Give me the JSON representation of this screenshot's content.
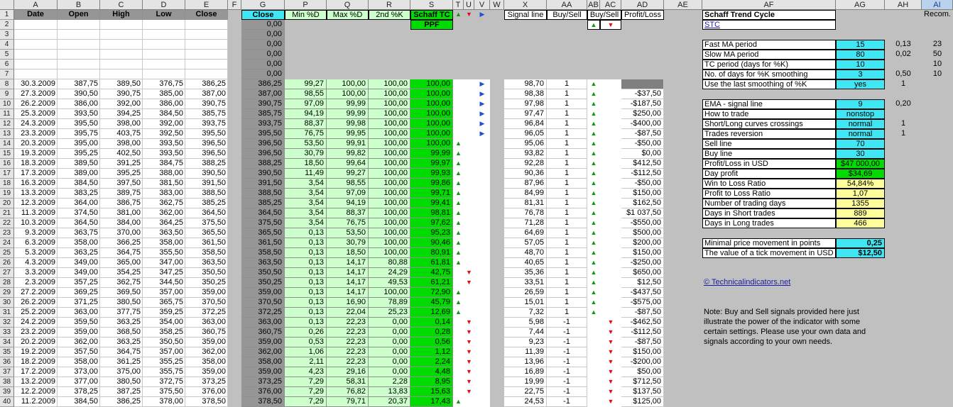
{
  "columns": [
    "",
    "A",
    "B",
    "C",
    "D",
    "E",
    "F",
    "G",
    "P",
    "Q",
    "R",
    "S",
    "T",
    "U",
    "V",
    "W",
    "X",
    "AA",
    "AB",
    "AC",
    "AD",
    "AE",
    "AF",
    "AG",
    "AH",
    "AI"
  ],
  "selected_column": "AI",
  "headers": {
    "A": "Date",
    "B": "Open",
    "C": "High",
    "D": "Low",
    "E": "Close",
    "G": "Close",
    "P": "Min %D",
    "Q": "Max %D",
    "R": "2nd %K",
    "S1": "Schaff TC",
    "S2": "PPF",
    "X": "Signal line",
    "AA": "Buy/Sell",
    "AC": "Buy/Sell",
    "AD": "Profit/Loss",
    "AF": "Schaff Trend Cycle",
    "AI": "Recom."
  },
  "top_arrows": {
    "T": "▲",
    "U": "▼",
    "V": "▶",
    "AB2": "▲",
    "AC2": "▼"
  },
  "stc_link": "STC",
  "empty_close": "0,00",
  "rows": [
    {
      "n": 8,
      "A": "30.3.2009",
      "B": "387,75",
      "C": "389,50",
      "D": "376,75",
      "E": "386,25",
      "G": "386,25",
      "P": "99,27",
      "Q": "100,00",
      "R": "100,00",
      "S": "100,00",
      "T": "",
      "U": "",
      "V": "▶",
      "X": "98,70",
      "AA": "1",
      "AB": "▲",
      "AC": "",
      "AD": ""
    },
    {
      "n": 9,
      "A": "27.3.2009",
      "B": "390,50",
      "C": "390,75",
      "D": "385,00",
      "E": "387,00",
      "G": "387,00",
      "P": "98,55",
      "Q": "100,00",
      "R": "100,00",
      "S": "100,00",
      "T": "",
      "U": "",
      "V": "▶",
      "X": "98,38",
      "AA": "1",
      "AB": "▲",
      "AC": "",
      "AD": "-$37,50"
    },
    {
      "n": 10,
      "A": "26.2.2009",
      "B": "386,00",
      "C": "392,00",
      "D": "386,00",
      "E": "390,75",
      "G": "390,75",
      "P": "97,09",
      "Q": "99,99",
      "R": "100,00",
      "S": "100,00",
      "T": "",
      "U": "",
      "V": "▶",
      "X": "97,98",
      "AA": "1",
      "AB": "▲",
      "AC": "",
      "AD": "-$187,50"
    },
    {
      "n": 11,
      "A": "25.3.2009",
      "B": "393,50",
      "C": "394,25",
      "D": "384,50",
      "E": "385,75",
      "G": "385,75",
      "P": "94,19",
      "Q": "99,99",
      "R": "100,00",
      "S": "100,00",
      "T": "",
      "U": "",
      "V": "▶",
      "X": "97,47",
      "AA": "1",
      "AB": "▲",
      "AC": "",
      "AD": "$250,00"
    },
    {
      "n": 12,
      "A": "24.3.2009",
      "B": "395,50",
      "C": "398,00",
      "D": "392,00",
      "E": "393,75",
      "G": "393,75",
      "P": "88,37",
      "Q": "99,98",
      "R": "100,00",
      "S": "100,00",
      "T": "",
      "U": "",
      "V": "▶",
      "X": "96,84",
      "AA": "1",
      "AB": "▲",
      "AC": "",
      "AD": "-$400,00"
    },
    {
      "n": 13,
      "A": "23.3.2009",
      "B": "395,75",
      "C": "403,75",
      "D": "392,50",
      "E": "395,50",
      "G": "395,50",
      "P": "76,75",
      "Q": "99,95",
      "R": "100,00",
      "S": "100,00",
      "T": "",
      "U": "",
      "V": "▶",
      "X": "96,05",
      "AA": "1",
      "AB": "▲",
      "AC": "",
      "AD": "-$87,50"
    },
    {
      "n": 14,
      "A": "20.3.2009",
      "B": "395,00",
      "C": "398,00",
      "D": "393,50",
      "E": "396,50",
      "G": "396,50",
      "P": "53,50",
      "Q": "99,91",
      "R": "100,00",
      "S": "100,00",
      "T": "▲",
      "U": "",
      "V": "",
      "X": "95,06",
      "AA": "1",
      "AB": "▲",
      "AC": "",
      "AD": "-$50,00"
    },
    {
      "n": 15,
      "A": "19.3.2009",
      "B": "395,25",
      "C": "402,50",
      "D": "393,50",
      "E": "396,50",
      "G": "396,50",
      "P": "30,79",
      "Q": "99,82",
      "R": "100,00",
      "S": "99,99",
      "T": "▲",
      "U": "",
      "V": "",
      "X": "93,82",
      "AA": "1",
      "AB": "▲",
      "AC": "",
      "AD": "$0,00"
    },
    {
      "n": 16,
      "A": "18.3.2009",
      "B": "389,50",
      "C": "391,25",
      "D": "384,75",
      "E": "388,25",
      "G": "388,25",
      "P": "18,50",
      "Q": "99,64",
      "R": "100,00",
      "S": "99,97",
      "T": "▲",
      "U": "",
      "V": "",
      "X": "92,28",
      "AA": "1",
      "AB": "▲",
      "AC": "",
      "AD": "$412,50"
    },
    {
      "n": 17,
      "A": "17.3.2009",
      "B": "389,00",
      "C": "395,25",
      "D": "388,00",
      "E": "390,50",
      "G": "390,50",
      "P": "11,49",
      "Q": "99,27",
      "R": "100,00",
      "S": "99,93",
      "T": "▲",
      "U": "",
      "V": "",
      "X": "90,36",
      "AA": "1",
      "AB": "▲",
      "AC": "",
      "AD": "-$112,50"
    },
    {
      "n": 18,
      "A": "16.3.2009",
      "B": "384,50",
      "C": "397,50",
      "D": "381,50",
      "E": "391,50",
      "G": "391,50",
      "P": "3,54",
      "Q": "98,55",
      "R": "100,00",
      "S": "99,86",
      "T": "▲",
      "U": "",
      "V": "",
      "X": "87,96",
      "AA": "1",
      "AB": "▲",
      "AC": "",
      "AD": "-$50,00"
    },
    {
      "n": 19,
      "A": "13.3.2009",
      "B": "383,25",
      "C": "389,75",
      "D": "383,00",
      "E": "388,50",
      "G": "388,50",
      "P": "3,54",
      "Q": "97,09",
      "R": "100,00",
      "S": "99,71",
      "T": "▲",
      "U": "",
      "V": "",
      "X": "84,99",
      "AA": "1",
      "AB": "▲",
      "AC": "",
      "AD": "$150,00"
    },
    {
      "n": 20,
      "A": "12.3.2009",
      "B": "364,00",
      "C": "386,75",
      "D": "362,75",
      "E": "385,25",
      "G": "385,25",
      "P": "3,54",
      "Q": "94,19",
      "R": "100,00",
      "S": "99,41",
      "T": "▲",
      "U": "",
      "V": "",
      "X": "81,31",
      "AA": "1",
      "AB": "▲",
      "AC": "",
      "AD": "$162,50"
    },
    {
      "n": 21,
      "A": "11.3.2009",
      "B": "374,50",
      "C": "381,00",
      "D": "362,00",
      "E": "364,50",
      "G": "364,50",
      "P": "3,54",
      "Q": "88,37",
      "R": "100,00",
      "S": "98,81",
      "T": "▲",
      "U": "",
      "V": "",
      "X": "76,78",
      "AA": "1",
      "AB": "▲",
      "AC": "",
      "AD": "$1 037,50"
    },
    {
      "n": 22,
      "A": "10.3.2009",
      "B": "364,50",
      "C": "384,00",
      "D": "364,25",
      "E": "375,50",
      "G": "375,50",
      "P": "3,54",
      "Q": "76,75",
      "R": "100,00",
      "S": "97,62",
      "T": "▲",
      "U": "",
      "V": "",
      "X": "71,28",
      "AA": "1",
      "AB": "▲",
      "AC": "",
      "AD": "-$550,00"
    },
    {
      "n": 23,
      "A": "9.3.2009",
      "B": "363,75",
      "C": "370,00",
      "D": "363,50",
      "E": "365,50",
      "G": "365,50",
      "P": "0,13",
      "Q": "53,50",
      "R": "100,00",
      "S": "95,23",
      "T": "▲",
      "U": "",
      "V": "",
      "X": "64,69",
      "AA": "1",
      "AB": "▲",
      "AC": "",
      "AD": "$500,00"
    },
    {
      "n": 24,
      "A": "6.3.2009",
      "B": "358,00",
      "C": "366,25",
      "D": "358,00",
      "E": "361,50",
      "G": "361,50",
      "P": "0,13",
      "Q": "30,79",
      "R": "100,00",
      "S": "90,46",
      "T": "▲",
      "U": "",
      "V": "",
      "X": "57,05",
      "AA": "1",
      "AB": "▲",
      "AC": "",
      "AD": "$200,00"
    },
    {
      "n": 25,
      "A": "5.3.2009",
      "B": "363,25",
      "C": "364,75",
      "D": "355,50",
      "E": "358,50",
      "G": "358,50",
      "P": "0,13",
      "Q": "18,50",
      "R": "100,00",
      "S": "80,91",
      "T": "▲",
      "U": "",
      "V": "",
      "X": "48,70",
      "AA": "1",
      "AB": "▲",
      "AC": "",
      "AD": "$150,00"
    },
    {
      "n": 26,
      "A": "4.3.2009",
      "B": "349,00",
      "C": "365,00",
      "D": "347,00",
      "E": "363,50",
      "G": "363,50",
      "P": "0,13",
      "Q": "14,17",
      "R": "80,88",
      "S": "61,81",
      "T": "▲",
      "U": "",
      "V": "",
      "X": "40,65",
      "AA": "1",
      "AB": "▲",
      "AC": "",
      "AD": "-$250,00"
    },
    {
      "n": 27,
      "A": "3.3.2009",
      "B": "349,00",
      "C": "354,25",
      "D": "347,25",
      "E": "350,50",
      "G": "350,50",
      "P": "0,13",
      "Q": "14,17",
      "R": "24,29",
      "S": "42,75",
      "T": "",
      "U": "▼",
      "V": "",
      "X": "35,36",
      "AA": "1",
      "AB": "▲",
      "AC": "",
      "AD": "$650,00"
    },
    {
      "n": 28,
      "A": "2.3.2009",
      "B": "357,25",
      "C": "362,75",
      "D": "344,50",
      "E": "350,25",
      "G": "350,25",
      "P": "0,13",
      "Q": "14,17",
      "R": "49,53",
      "S": "61,21",
      "T": "",
      "U": "▼",
      "V": "",
      "X": "33,51",
      "AA": "1",
      "AB": "▲",
      "AC": "",
      "AD": "$12,50"
    },
    {
      "n": 29,
      "A": "27.2.2009",
      "B": "369,25",
      "C": "369,50",
      "D": "357,00",
      "E": "359,00",
      "G": "359,00",
      "P": "0,13",
      "Q": "14,17",
      "R": "100,00",
      "S": "72,90",
      "T": "▲",
      "U": "",
      "V": "",
      "X": "26,59",
      "AA": "1",
      "AB": "▲",
      "AC": "",
      "AD": "-$437,50"
    },
    {
      "n": 30,
      "A": "26.2.2009",
      "B": "371,25",
      "C": "380,50",
      "D": "365,75",
      "E": "370,50",
      "G": "370,50",
      "P": "0,13",
      "Q": "16,90",
      "R": "78,89",
      "S": "45,79",
      "T": "▲",
      "U": "",
      "V": "",
      "X": "15,01",
      "AA": "1",
      "AB": "▲",
      "AC": "",
      "AD": "-$575,00"
    },
    {
      "n": 31,
      "A": "25.2.2009",
      "B": "363,00",
      "C": "377,75",
      "D": "359,25",
      "E": "372,25",
      "G": "372,25",
      "P": "0,13",
      "Q": "22,04",
      "R": "25,23",
      "S": "12,69",
      "T": "▲",
      "U": "",
      "V": "",
      "X": "7,32",
      "AA": "1",
      "AB": "▲",
      "AC": "",
      "AD": "-$87,50"
    },
    {
      "n": 32,
      "A": "24.2.2009",
      "B": "359,50",
      "C": "363,25",
      "D": "354,00",
      "E": "363,00",
      "G": "363,00",
      "P": "0,13",
      "Q": "22,23",
      "R": "0,00",
      "S": "0,14",
      "T": "",
      "U": "▼",
      "V": "",
      "X": "5,98",
      "AA": "-1",
      "AB": "",
      "AC": "▼",
      "AD": "-$462,50"
    },
    {
      "n": 33,
      "A": "23.2.2009",
      "B": "359,00",
      "C": "368,50",
      "D": "358,25",
      "E": "360,75",
      "G": "360,75",
      "P": "0,26",
      "Q": "22,23",
      "R": "0,00",
      "S": "0,28",
      "T": "",
      "U": "▼",
      "V": "",
      "X": "7,44",
      "AA": "-1",
      "AB": "",
      "AC": "▼",
      "AD": "-$112,50"
    },
    {
      "n": 34,
      "A": "20.2.2009",
      "B": "362,00",
      "C": "363,25",
      "D": "350,50",
      "E": "359,00",
      "G": "359,00",
      "P": "0,53",
      "Q": "22,23",
      "R": "0,00",
      "S": "0,56",
      "T": "",
      "U": "▼",
      "V": "",
      "X": "9,23",
      "AA": "-1",
      "AB": "",
      "AC": "▼",
      "AD": "-$87,50"
    },
    {
      "n": 35,
      "A": "19.2.2009",
      "B": "357,50",
      "C": "364,75",
      "D": "357,00",
      "E": "362,00",
      "G": "362,00",
      "P": "1,06",
      "Q": "22,23",
      "R": "0,00",
      "S": "1,12",
      "T": "",
      "U": "▼",
      "V": "",
      "X": "11,39",
      "AA": "-1",
      "AB": "",
      "AC": "▼",
      "AD": "$150,00"
    },
    {
      "n": 36,
      "A": "18.2.2009",
      "B": "358,00",
      "C": "361,25",
      "D": "355,25",
      "E": "358,00",
      "G": "358,00",
      "P": "2,11",
      "Q": "22,23",
      "R": "0,00",
      "S": "2,24",
      "T": "",
      "U": "▼",
      "V": "",
      "X": "13,96",
      "AA": "-1",
      "AB": "",
      "AC": "▼",
      "AD": "-$200,00"
    },
    {
      "n": 37,
      "A": "17.2.2009",
      "B": "373,00",
      "C": "375,00",
      "D": "355,75",
      "E": "359,00",
      "G": "359,00",
      "P": "4,23",
      "Q": "29,16",
      "R": "0,00",
      "S": "4,48",
      "T": "",
      "U": "▼",
      "V": "",
      "X": "16,89",
      "AA": "-1",
      "AB": "",
      "AC": "▼",
      "AD": "$50,00"
    },
    {
      "n": 38,
      "A": "13.2.2009",
      "B": "377,00",
      "C": "380,50",
      "D": "372,75",
      "E": "373,25",
      "G": "373,25",
      "P": "7,29",
      "Q": "58,31",
      "R": "2,28",
      "S": "8,95",
      "T": "",
      "U": "▼",
      "V": "",
      "X": "19,99",
      "AA": "-1",
      "AB": "",
      "AC": "▼",
      "AD": "$712,50"
    },
    {
      "n": 39,
      "A": "12.2.2009",
      "B": "378,25",
      "C": "387,25",
      "D": "375,50",
      "E": "376,00",
      "G": "376,00",
      "P": "7,29",
      "Q": "76,82",
      "R": "13,83",
      "S": "15,63",
      "T": "",
      "U": "▼",
      "V": "",
      "X": "22,75",
      "AA": "-1",
      "AB": "",
      "AC": "▼",
      "AD": "$137,50"
    },
    {
      "n": 40,
      "A": "11.2.2009",
      "B": "384,50",
      "C": "386,25",
      "D": "378,00",
      "E": "378,50",
      "G": "378,50",
      "P": "7,29",
      "Q": "79,71",
      "R": "20,37",
      "S": "17,43",
      "T": "▲",
      "U": "",
      "V": "",
      "X": "24,53",
      "AA": "-1",
      "AB": "",
      "AC": "▼",
      "AD": "$125,00"
    }
  ],
  "params": [
    {
      "row": 4,
      "label": "Fast MA period",
      "value": "15",
      "color": "#3fe7f4",
      "AH": "0,13",
      "AI": "23"
    },
    {
      "row": 5,
      "label": "Slow MA period",
      "value": "80",
      "color": "#3fe7f4",
      "AH": "0,02",
      "AI": "50"
    },
    {
      "row": 6,
      "label": "TC period (days for %K)",
      "value": "10",
      "color": "#3fe7f4",
      "AH": "",
      "AI": "10"
    },
    {
      "row": 7,
      "label": "No. of days for %K smoothing",
      "value": "3",
      "color": "#3fe7f4",
      "AH": "0,50",
      "AI": "10"
    },
    {
      "row": 8,
      "label": "Use the last smoothing of %K",
      "value": "yes",
      "color": "#3fe7f4",
      "AH": "1",
      "AI": ""
    },
    {
      "row": 10,
      "label": "EMA - signal line",
      "value": "9",
      "color": "#3fe7f4",
      "AH": "0,20",
      "AI": ""
    },
    {
      "row": 11,
      "label": "How to trade",
      "value": "nonstop",
      "color": "#3fe7f4",
      "AH": "",
      "AI": ""
    },
    {
      "row": 12,
      "label": "Short/Long curves crossings",
      "value": "normal",
      "color": "#3fe7f4",
      "AH": "1",
      "AI": ""
    },
    {
      "row": 13,
      "label": "Trades reversion",
      "value": "normal",
      "color": "#3fe7f4",
      "AH": "1",
      "AI": ""
    },
    {
      "row": 14,
      "label": "Sell line",
      "value": "70",
      "color": "#3fe7f4",
      "AH": "",
      "AI": ""
    },
    {
      "row": 15,
      "label": "Buy line",
      "value": "30",
      "color": "#3fe7f4",
      "AH": "",
      "AI": ""
    },
    {
      "row": 16,
      "label": "Profit/Loss in USD",
      "value": "$47 000,00",
      "color": "#00dc00",
      "AH": "",
      "AI": ""
    },
    {
      "row": 17,
      "label": "Day profit",
      "value": "$34,69",
      "color": "#00dc00",
      "AH": "",
      "AI": ""
    },
    {
      "row": 18,
      "label": "Win to Loss Ratio",
      "value": "54,84%",
      "color": "#ffff99",
      "AH": "",
      "AI": ""
    },
    {
      "row": 19,
      "label": "Profit to Loss Ratio",
      "value": "1,07",
      "color": "#ffff99",
      "AH": "",
      "AI": ""
    },
    {
      "row": 20,
      "label": "Number of trading days",
      "value": "1355",
      "color": "#ffff99",
      "AH": "",
      "AI": ""
    },
    {
      "row": 21,
      "label": "Days in Short trades",
      "value": "889",
      "color": "#ffff99",
      "AH": "",
      "AI": ""
    },
    {
      "row": 22,
      "label": "Days in Long trades",
      "value": "466",
      "color": "#ffff99",
      "AH": "",
      "AI": ""
    },
    {
      "row": 24,
      "label": "Minimal price movement in points",
      "value": "0,25",
      "color": "#3fe7f4",
      "AH": "",
      "AI": ""
    },
    {
      "row": 25,
      "label": "The value of a tick movement in USD",
      "value": "$12,50",
      "color": "#3fe7f4",
      "AH": "",
      "AI": ""
    }
  ],
  "website_link": "© Technicalindicators.net",
  "note": [
    "Note: Buy and Sell signals provided here just",
    "illustrate the power of the indicator with some",
    "certain settings. Please use your own data and",
    "signals according to your own needs."
  ],
  "colors": {
    "teal": "#3fe7f4",
    "green": "#00dc00",
    "yellow": "#ffff99",
    "lightgreen": "#ccffcc",
    "gray": "#969696",
    "darkgray": "#808080",
    "header_selected": "#b9d2ee"
  }
}
